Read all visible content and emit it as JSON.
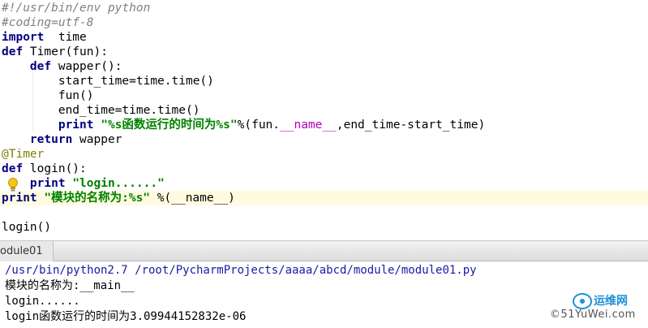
{
  "editor": {
    "lines": [
      [
        {
          "t": "#!/usr/bin/env python",
          "c": "cm"
        }
      ],
      [
        {
          "t": "#coding=utf-8",
          "c": "cm"
        }
      ],
      [
        {
          "t": "import",
          "c": "kw"
        },
        {
          "t": "  time",
          "c": ""
        }
      ],
      [
        {
          "t": "def",
          "c": "kw"
        },
        {
          "t": " Timer(fun):",
          "c": ""
        }
      ],
      [
        {
          "t": "    ",
          "c": ""
        },
        {
          "t": "def",
          "c": "kw"
        },
        {
          "t": " wapper():",
          "c": ""
        }
      ],
      [
        {
          "t": "        start_time=time.time()",
          "c": ""
        }
      ],
      [
        {
          "t": "        fun()",
          "c": ""
        }
      ],
      [
        {
          "t": "        end_time=time.time()",
          "c": ""
        }
      ],
      [
        {
          "t": "        ",
          "c": ""
        },
        {
          "t": "print",
          "c": "kw"
        },
        {
          "t": " ",
          "c": ""
        },
        {
          "t": "\"%s函数运行的时间为%s\"",
          "c": "st"
        },
        {
          "t": "%(fun.",
          "c": ""
        },
        {
          "t": "__name__",
          "c": "magic"
        },
        {
          "t": ",end_time-start_time)",
          "c": ""
        }
      ],
      [
        {
          "t": "    ",
          "c": ""
        },
        {
          "t": "return",
          "c": "kw"
        },
        {
          "t": " wapper",
          "c": ""
        }
      ],
      [
        {
          "t": "@Timer",
          "c": "dec"
        }
      ],
      [
        {
          "t": "def",
          "c": "kw"
        },
        {
          "t": " login():",
          "c": ""
        }
      ],
      [
        {
          "t": "    ",
          "c": ""
        },
        {
          "t": "print",
          "c": "kw"
        },
        {
          "t": " ",
          "c": ""
        },
        {
          "t": "\"login......\"",
          "c": "st"
        }
      ],
      [
        {
          "t": "print",
          "c": "kw"
        },
        {
          "t": " ",
          "c": ""
        },
        {
          "t": "\"模块的名称为:%s\"",
          "c": "st"
        },
        {
          "t": " %(__name__)",
          "c": ""
        }
      ],
      [
        {
          "t": "",
          "c": ""
        }
      ],
      [
        {
          "t": "login()",
          "c": ""
        }
      ]
    ],
    "highlight_line": 13
  },
  "run_panel": {
    "tab_label": "odule01"
  },
  "console": {
    "command": "/usr/bin/python2.7 /root/PycharmProjects/aaaa/abcd/module/module01.py",
    "output": [
      "模块的名称为:__main__",
      "login......",
      "login函数运行的时间为3.09944152832e-06"
    ]
  },
  "watermark": {
    "title": "运维网",
    "subtitle": "©51YuWei.com"
  },
  "colors": {
    "keyword": "#000080",
    "comment": "#808080",
    "string": "#008000",
    "magic": "#b200b2",
    "decorator": "#808000",
    "console_cmd": "#1a1aa8",
    "line_highlight": "#fffbe0"
  }
}
